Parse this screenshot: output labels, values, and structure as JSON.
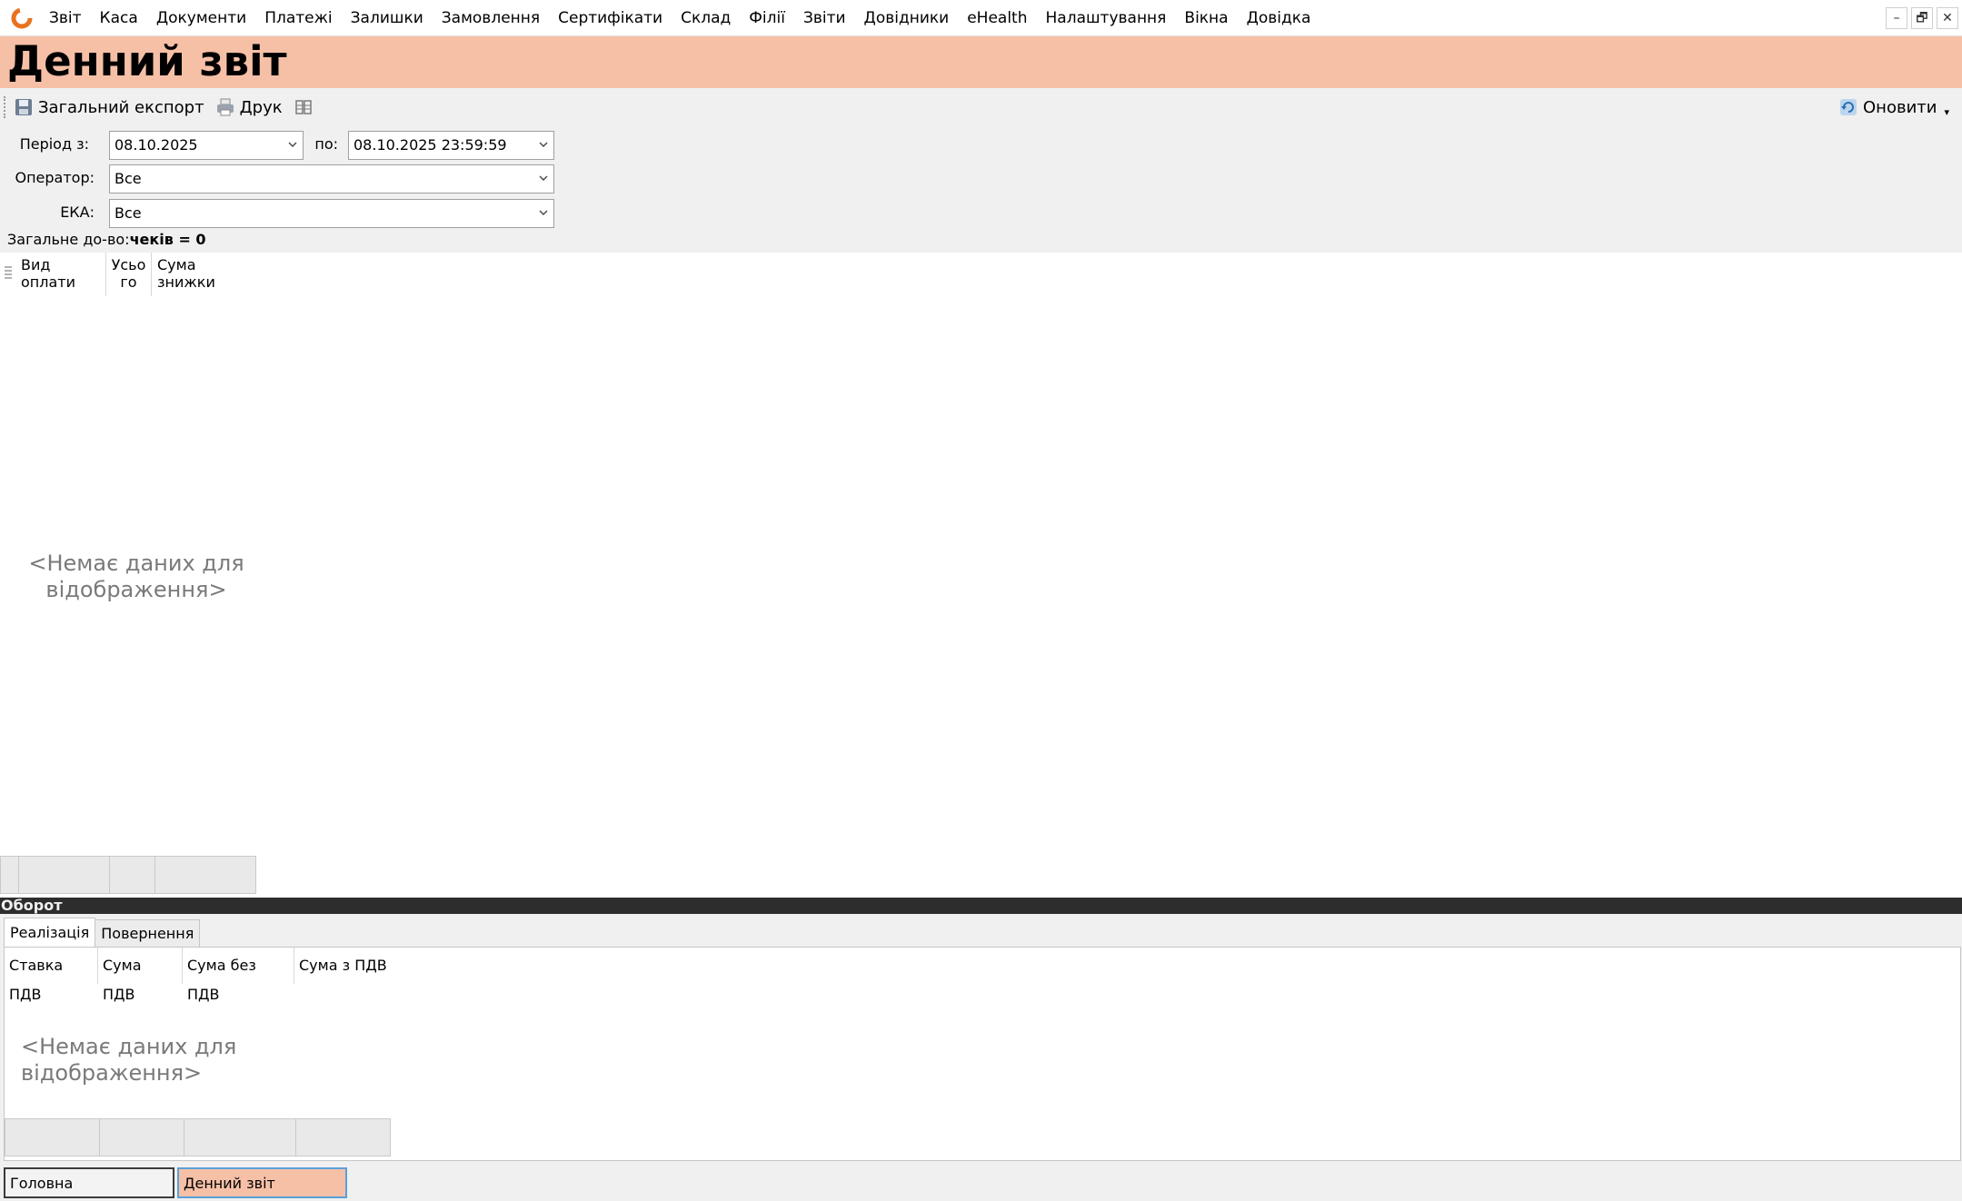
{
  "menu": {
    "items": [
      "Звіт",
      "Каса",
      "Документи",
      "Платежі",
      "Залишки",
      "Замовлення",
      "Сертифікати",
      "Склад",
      "Філії",
      "Звіти",
      "Довідники",
      "eHealth",
      "Налаштування",
      "Вікна",
      "Довідка"
    ]
  },
  "window_controls": {
    "minimize": "–",
    "restore": "🗗",
    "close": "✕"
  },
  "page": {
    "title": "Денний звіт"
  },
  "toolbar": {
    "export_label": "Загальний експорт",
    "print_label": "Друк",
    "refresh_label": "Оновити",
    "refresh_arrow": "▾"
  },
  "filters": {
    "period_from_label": "Період з:",
    "period_from_value": "08.10.2025",
    "period_to_label": "по:",
    "period_to_value": "08.10.2025 23:59:59",
    "operator_label": "Оператор:",
    "operator_value": "Все",
    "eka_label": "ЕКА:",
    "eka_value": "Все"
  },
  "summary": {
    "label": "Загальне до-во:",
    "value": "чеків = 0"
  },
  "payments_grid": {
    "columns": [
      "Вид оплати",
      "Усьо\nго",
      "Сума знижки"
    ],
    "empty_text": "<Немає даних для\nвідображення>"
  },
  "turnover": {
    "section_title": "Оборот",
    "tabs": [
      "Реалізація",
      "Повернення"
    ],
    "active_tab": "Реалізація",
    "columns": [
      "Ставка ПДВ",
      "Сума ПДВ",
      "Сума без ПДВ",
      "Сума з ПДВ"
    ],
    "empty_text": "<Немає даних для відображення>"
  },
  "taskbar": {
    "tabs": [
      "Головна",
      "Денний звіт"
    ],
    "active": "Денний звіт"
  },
  "colors": {
    "accent": "#f6c0a7",
    "logo": "#e8731f",
    "splitter": "#2d2d2d",
    "active_tab_border": "#5aa0d8"
  },
  "icons": {
    "logo": "app-logo-icon",
    "export": "save-disk-icon",
    "print": "printer-icon",
    "columns": "column-chooser-icon",
    "refresh": "refresh-icon"
  }
}
